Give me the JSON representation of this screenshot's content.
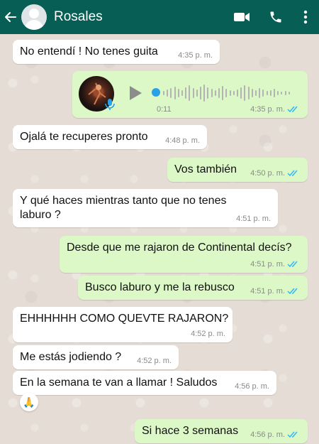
{
  "header": {
    "contact_name": "Rosales"
  },
  "colors": {
    "header": "#075e54",
    "incoming": "#ffffff",
    "outgoing": "#dcf8c6",
    "read_ticks": "#34b7f1"
  },
  "messages": [
    {
      "dir": "in",
      "text": "No entendí ! No tenes  guita",
      "time": "4:35 p. m."
    },
    {
      "dir": "out",
      "type": "voice",
      "duration": "0:11",
      "time": "4:35 p. m.",
      "read": true
    },
    {
      "dir": "in",
      "text": "Ojalá te recuperes pronto",
      "time": "4:48 p. m."
    },
    {
      "dir": "out",
      "text": "Vos también",
      "time": "4:50 p. m.",
      "read": true
    },
    {
      "dir": "in",
      "text_line1": "Y qué haces mientras tanto que no tenes",
      "text_line2": "laburo ?",
      "time": "4:51 p. m."
    },
    {
      "dir": "out",
      "text": "Desde que me rajaron de Continental decís?",
      "time": "4:51 p. m.",
      "read": true
    },
    {
      "dir": "out",
      "text": "Busco laburo y me la rebusco",
      "time": "4:51 p. m.",
      "read": true
    },
    {
      "dir": "in",
      "text": "EHHHHHH COMO QUEVTE RAJARON?",
      "time": "4:52 p. m."
    },
    {
      "dir": "in",
      "text": "Me estás jodiendo ?",
      "time": "4:52 p. m."
    },
    {
      "dir": "in",
      "text": "En la semana te van a llamar ! Saludos",
      "time": "4:56 p. m.",
      "reaction": "🙏"
    },
    {
      "dir": "out",
      "text": "Si hace 3 semanas",
      "time": "4:56 p. m.",
      "read": true
    }
  ]
}
